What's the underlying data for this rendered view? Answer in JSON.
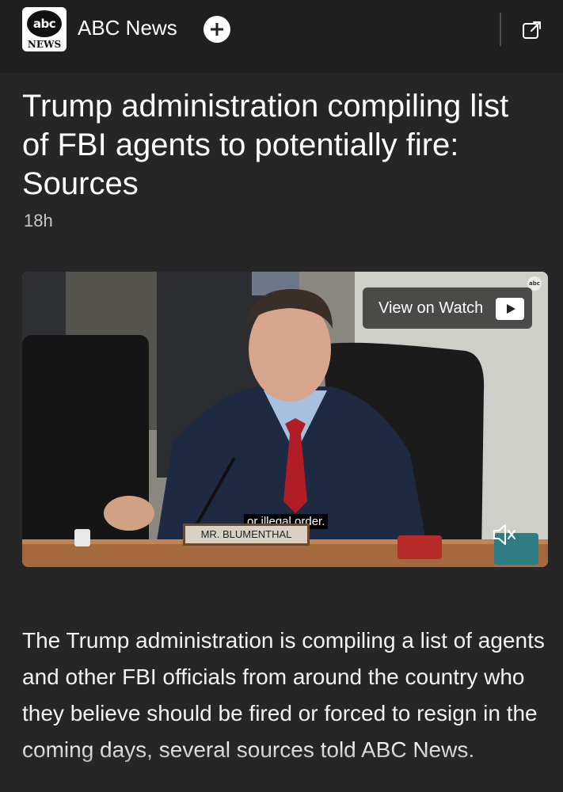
{
  "header": {
    "logo_top": "abc",
    "logo_bottom": "NEWS",
    "publisher": "ABC News",
    "follow_icon": "plus-icon",
    "open_icon": "external-link-icon"
  },
  "article": {
    "headline": "Trump administration compiling list of FBI agents to potentially fire: Sources",
    "age": "18h",
    "body": "The Trump administration is compiling a list of agents and other FBI officials from around the country who they believe should be fired or forced to resign in the coming days, several sources told ABC News."
  },
  "video": {
    "watch_label": "View on Watch",
    "caption": "or illegal order.",
    "nameplate": "MR. BLUMENTHAL",
    "watermark": "abc"
  },
  "colors": {
    "background": "#262626",
    "header_bg": "#1f1f1f",
    "text": "#ffffff",
    "muted_text": "#c8c8c8"
  }
}
